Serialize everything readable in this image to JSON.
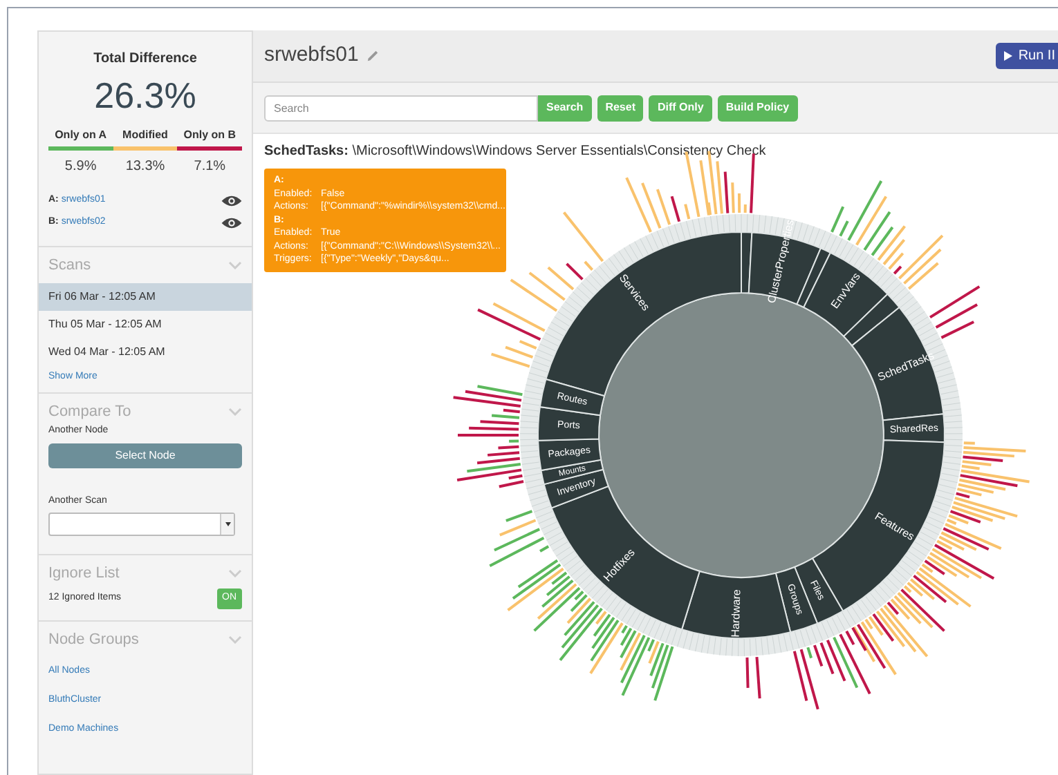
{
  "sidebar": {
    "summary": {
      "title": "Total Difference",
      "total": "26.3%",
      "legend": [
        {
          "label": "Only on A",
          "value": "5.9%",
          "color": "#5cb85c"
        },
        {
          "label": "Modified",
          "value": "13.3%",
          "color": "#f9c26c"
        },
        {
          "label": "Only on B",
          "value": "7.1%",
          "color": "#c0174a"
        }
      ],
      "nodes": [
        {
          "key": "A:",
          "name": "srwebfs01"
        },
        {
          "key": "B:",
          "name": "srwebfs02"
        }
      ]
    },
    "scans": {
      "title": "Scans",
      "items": [
        {
          "label": "Fri 06 Mar - 12:05 AM",
          "selected": true
        },
        {
          "label": "Thu 05 Mar - 12:05 AM",
          "selected": false
        },
        {
          "label": "Wed 04 Mar - 12:05 AM",
          "selected": false
        }
      ],
      "more": "Show More"
    },
    "compare": {
      "title": "Compare To",
      "node_label": "Another Node",
      "node_button": "Select Node",
      "scan_label": "Another Scan"
    },
    "ignore": {
      "title": "Ignore List",
      "count": "12 Ignored Items",
      "toggle": "ON",
      "on": true
    },
    "node_groups": {
      "title": "Node Groups",
      "items": [
        "All Nodes",
        "BluthCluster",
        "Demo Machines"
      ]
    }
  },
  "header": {
    "title": "srwebfs01",
    "run_button": "Run II"
  },
  "toolbar": {
    "search_placeholder": "Search",
    "buttons": [
      "Search",
      "Reset",
      "Diff Only",
      "Build Policy"
    ]
  },
  "path": "**SchedTasks:** \\Microsoft\\Windows\\Windows Server Essentials\\Consistency Check",
  "tooltip": [
    {
      "heading": "A:",
      "rows": [
        {
          "key": "Enabled:",
          "value": "False"
        },
        {
          "key": "Actions:",
          "value": "[{\"Command\":\"%windir%\\\\system32\\\\cmd..."
        }
      ]
    },
    {
      "heading": "B:",
      "rows": [
        {
          "key": "Enabled:",
          "value": "True"
        },
        {
          "key": "Actions:",
          "value": "[{\"Command\":\"C:\\\\Windows\\\\System32\\\\..."
        },
        {
          "key": "Triggers:",
          "value": "[{\"Type\":\"Weekly\",\"Days&qu..."
        }
      ]
    }
  ],
  "sunburst": {
    "segment_labels": [
      "Services",
      "ClusterProperties",
      "EnvVars",
      "SchedTasks",
      "SharedRes",
      "Features",
      "Files",
      "Groups",
      "Hardware",
      "Hotfixes",
      "Inventory",
      "Mounts",
      "Packages",
      "Ports",
      "Routes"
    ]
  }
}
